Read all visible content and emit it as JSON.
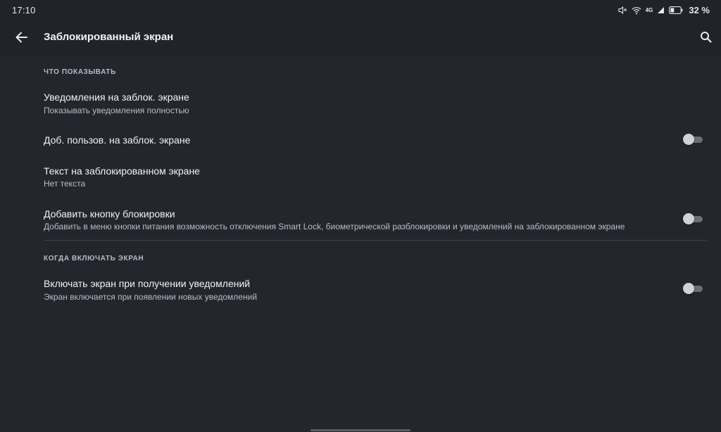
{
  "status_bar": {
    "time": "17:10",
    "network_label": "4G",
    "battery_percent": "32 %",
    "icons": [
      "mute-icon",
      "wifi-icon",
      "signal-icon",
      "battery-icon"
    ]
  },
  "app_bar": {
    "title": "Заблокированный экран",
    "back_icon": "arrow-left-icon",
    "search_icon": "search-icon"
  },
  "sections": [
    {
      "header": "ЧТО ПОКАЗЫВАТЬ",
      "items": [
        {
          "title": "Уведомления на заблок. экране",
          "summary": "Показывать уведомления полностью"
        },
        {
          "title": "Доб. пользов. на заблок. экране",
          "switch_on": false
        },
        {
          "title": "Текст на заблокированном экране",
          "summary": "Нет текста"
        },
        {
          "title": "Добавить кнопку блокировки",
          "summary": "Добавить в меню кнопки питания возможность отключения Smart Lock, биометрической разблокировки и уведомлений на заблокированном экране",
          "switch_on": false
        }
      ]
    },
    {
      "header": "КОГДА ВКЛЮЧАТЬ ЭКРАН",
      "items": [
        {
          "title": "Включать экран при получении уведомлений",
          "summary": "Экран включается при появлении новых уведомлений",
          "switch_on": false
        }
      ]
    }
  ],
  "colors": {
    "background": "#23272d",
    "app_bar": "#202328",
    "switch_track_off": "#6b6f75",
    "switch_thumb_off": "#cfd2d6"
  }
}
